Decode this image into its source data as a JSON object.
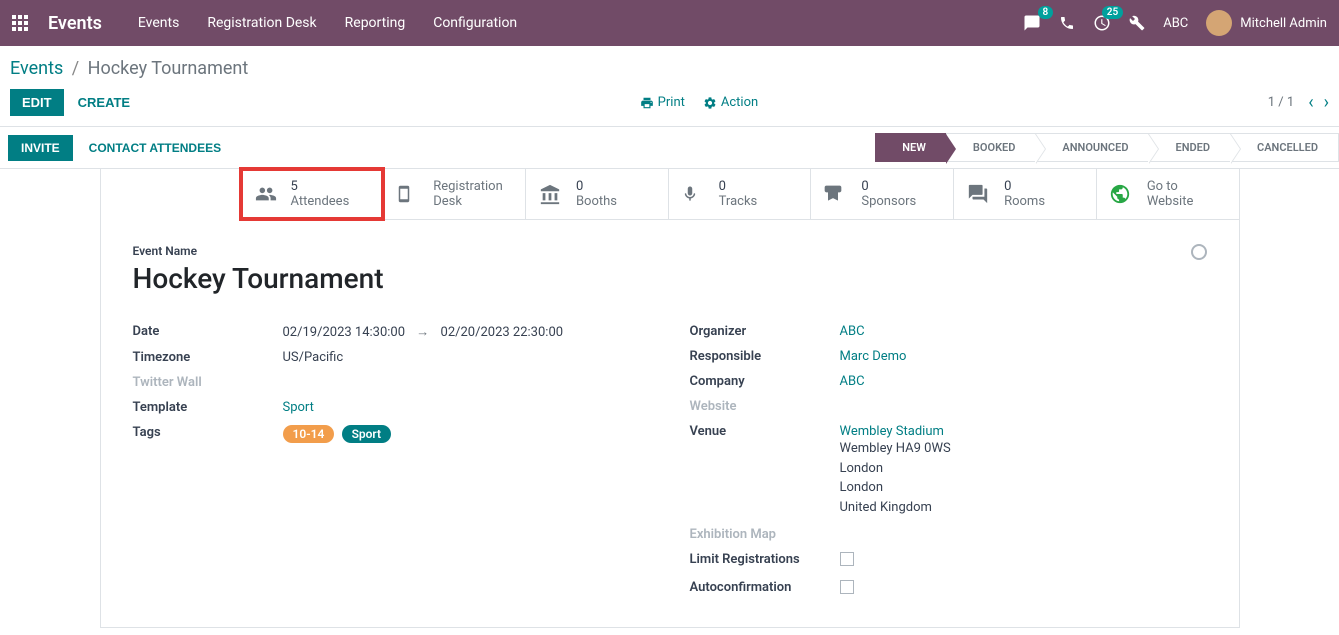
{
  "navbar": {
    "brand": "Events",
    "menu": [
      "Events",
      "Registration Desk",
      "Reporting",
      "Configuration"
    ],
    "messages_badge": "8",
    "activities_badge": "25",
    "company": "ABC",
    "user": "Mitchell Admin"
  },
  "breadcrumb": {
    "root": "Events",
    "current": "Hockey Tournament"
  },
  "control_panel": {
    "edit": "EDIT",
    "create": "CREATE",
    "print": "Print",
    "action": "Action",
    "pager": "1 / 1"
  },
  "status_bar": {
    "invite": "INVITE",
    "contact": "CONTACT ATTENDEES",
    "stages": [
      "NEW",
      "BOOKED",
      "ANNOUNCED",
      "ENDED",
      "CANCELLED"
    ],
    "active_stage": 0
  },
  "stats": {
    "attendees": {
      "count": "5",
      "label": "Attendees"
    },
    "reg_desk": {
      "label_l1": "Registration",
      "label_l2": "Desk"
    },
    "booths": {
      "count": "0",
      "label": "Booths"
    },
    "tracks": {
      "count": "0",
      "label": "Tracks"
    },
    "sponsors": {
      "count": "0",
      "label": "Sponsors"
    },
    "rooms": {
      "count": "0",
      "label": "Rooms"
    },
    "website": {
      "label_l1": "Go to",
      "label_l2": "Website"
    }
  },
  "form": {
    "name_label": "Event Name",
    "name": "Hockey Tournament",
    "labels": {
      "date": "Date",
      "timezone": "Timezone",
      "twitter": "Twitter Wall",
      "template": "Template",
      "tags": "Tags",
      "organizer": "Organizer",
      "responsible": "Responsible",
      "company": "Company",
      "website": "Website",
      "venue": "Venue",
      "exhibition": "Exhibition Map",
      "limit": "Limit Registrations",
      "autoconfirm": "Autoconfirmation"
    },
    "date_start": "02/19/2023 14:30:00",
    "date_end": "02/20/2023 22:30:00",
    "timezone": "US/Pacific",
    "template": "Sport",
    "tags": [
      {
        "text": "10-14",
        "class": "orange"
      },
      {
        "text": "Sport",
        "class": "teal"
      }
    ],
    "organizer": "ABC",
    "responsible": "Marc Demo",
    "company": "ABC",
    "venue_name": "Wembley Stadium",
    "venue_address": [
      "Wembley HA9 0WS",
      "London",
      "London",
      "United Kingdom"
    ]
  }
}
